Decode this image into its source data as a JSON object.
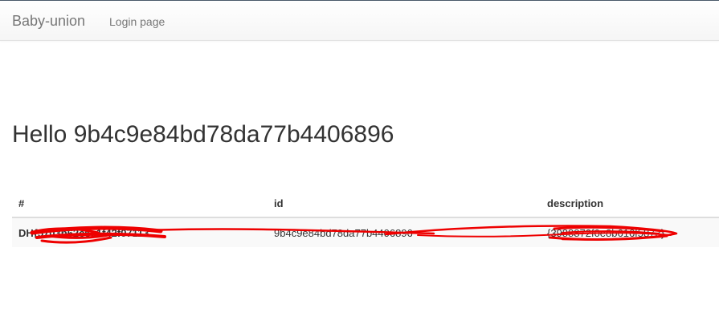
{
  "navbar": {
    "brand": "Baby-union",
    "links": [
      {
        "label": "Login page"
      }
    ]
  },
  "main": {
    "greeting": "Hello 9b4c9e84bd78da77b4406896"
  },
  "table": {
    "headers": [
      "#",
      "id",
      "description"
    ],
    "rows": [
      {
        "hash": "DH{5703b62c6c1f42f07113",
        "id": "9b4c9e84bd78da77b4406896",
        "description": "{3988872f0e8b616f5873}"
      }
    ]
  },
  "colors": {
    "brand_text": "#777777",
    "scribble": "#ee0000"
  }
}
